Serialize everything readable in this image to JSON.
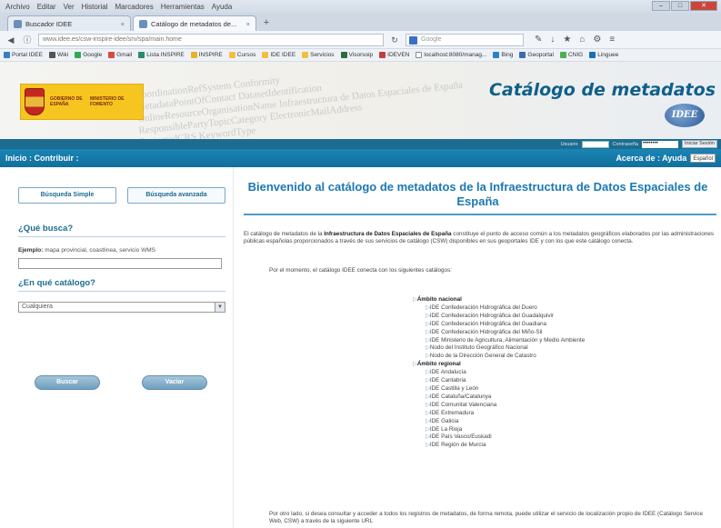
{
  "browser": {
    "menu": [
      "Archivo",
      "Editar",
      "Ver",
      "Historial",
      "Marcadores",
      "Herramientas",
      "Ayuda"
    ],
    "tabs": [
      {
        "label": "Buscador IDEE"
      },
      {
        "label": "Catálogo de metadatos de..."
      }
    ],
    "url": "www.idee.es/csw-inspire-idee/srv/spa/main.home",
    "url_host": "idee.es",
    "search_placeholder": "Google",
    "bookmarks": [
      "Portal IDEE",
      "Wiki",
      "Google",
      "Gmail",
      "Lista INSPIRE",
      "INSPIRE",
      "Cursos",
      "IDE IDEE",
      "Servicios",
      "Visorsoip",
      "IDEVEN",
      "localhost:8080/manag...",
      "Bing",
      "Geoportal",
      "CNIG",
      "Linguee"
    ]
  },
  "header": {
    "title": "Catálogo de metadatos",
    "idee_logo": "IDEE",
    "gov_text_1": "GOBIERNO DE ESPAÑA",
    "gov_text_2": "MINISTERIO DE FOMENTO",
    "watermark": [
      "CoordinationRefSystem Conformity",
      "MetadataPointOfContact  DatasetIdentification",
      "OnlineResourceOrganisationName  Infraestructura de Datos Espaciales de España",
      "ResponsiblePartyTopicCategory  ElectronicMailAddress",
      "ProjectedCRS  KeywordType"
    ]
  },
  "userbar": {
    "user_label": "Usuario",
    "password_label": "Contraseña",
    "password_value": "••••••••",
    "login_button": "Iniciar Sesión"
  },
  "nav": {
    "left": "Inicio : Contribuir :",
    "right": "Acerca de : Ayuda",
    "language": "Español"
  },
  "search": {
    "tab_simple": "Búsqueda Simple",
    "tab_advanced": "Búsqueda avanzada",
    "what_heading": "¿Qué busca?",
    "example_label": "Ejemplo:",
    "example_text": "mapa provincial, coastlinea, servicio WMS",
    "catalog_heading": "¿En qué catálogo?",
    "catalog_selected": "Cualquiera",
    "search_button": "Buscar",
    "clear_button": "Vaciar"
  },
  "content": {
    "welcome": "Bienvenido al catálogo de metadatos de la Infraestructura de Datos Espaciales de España",
    "intro_pre": "El catálogo de metadatos de la ",
    "intro_bold": "Infraestructura de Datos Espaciales de España",
    "intro_post": " constituye el punto de acceso común a los metadatos geográficos elaborados por las administraciones públicas españolas proporcionados a través de sus servicios de catálogo (CSW) disponibles en sus geoportales IDE y con los que este catálogo conecta.",
    "connect_text": "Por el momento, el catálogo IDEE conecta con los siguientes catálogos:",
    "groups": [
      {
        "label": "Ámbito nacional",
        "items": [
          "IDE Confederación Hidrográfica del Duero",
          "IDE Confederación Hidrográfica del Guadalquivir",
          "IDE Confederación Hidrográfica del Guadiana",
          "IDE Confederación Hidrográfica del Miño-Sil",
          "IDE Ministerio de Agricultura, Alimentación y Medio Ambiente",
          "Nodo del Instituto Geográfico Nacional",
          "Nodo de la Dirección General de Catastro"
        ]
      },
      {
        "label": "Ámbito regional",
        "items": [
          "IDE Andalucía",
          "IDE Cantabria",
          "IDE Castilla y León",
          "IDE Cataluña/Catalunya",
          "IDE Comunitat Valenciana",
          "IDE Extremadura",
          "IDE Galicia",
          "IDE La Rioja",
          "IDE País Vasco/Euskadi",
          "IDE Región de Murcia"
        ]
      }
    ],
    "footer_text": "Por otro lado, si desea consultar y acceder a todos los registros de metadatos, de forma remota, puede utilizar el servicio de localización propio de IDEE (Catálogo Service Web, CSW) a través de la siguiente URL"
  }
}
